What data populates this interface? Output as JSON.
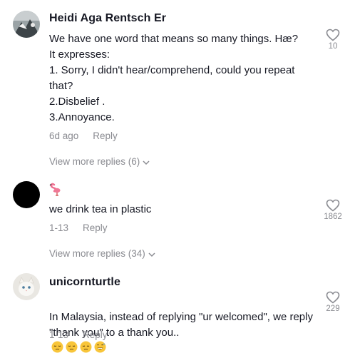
{
  "comments": [
    {
      "username": "Heidi Aga Rentsch Er",
      "text": "We have one word that means so many things. Hæ?\nIt expresses:\n1. Sorry, I didn't hear/comprehend, could you repeat that?\n2.Disbelief .\n3.Annoyance.",
      "time": "6d ago",
      "reply_label": "Reply",
      "likes": "10",
      "view_more": "View more replies (6)"
    },
    {
      "username": "",
      "username_icon": "flamingo-emoji",
      "text": "we drink tea in plastic",
      "time": "1-13",
      "reply_label": "Reply",
      "likes": "1862",
      "view_more": "View more replies (34)"
    },
    {
      "username": "unicornturtle",
      "text": "In Malaysia, instead of replying \"ur welcomed\", we reply \"thank you\" to a thank you..",
      "emojis": [
        "pensive-face",
        "pensive-face",
        "pensive-face",
        "grinning-sweat-face"
      ],
      "time": "1-13",
      "reply_label": "Reply",
      "likes": "229"
    }
  ],
  "colors": {
    "text": "#161823",
    "secondary": "#8a8b91",
    "background": "#ffffff"
  }
}
